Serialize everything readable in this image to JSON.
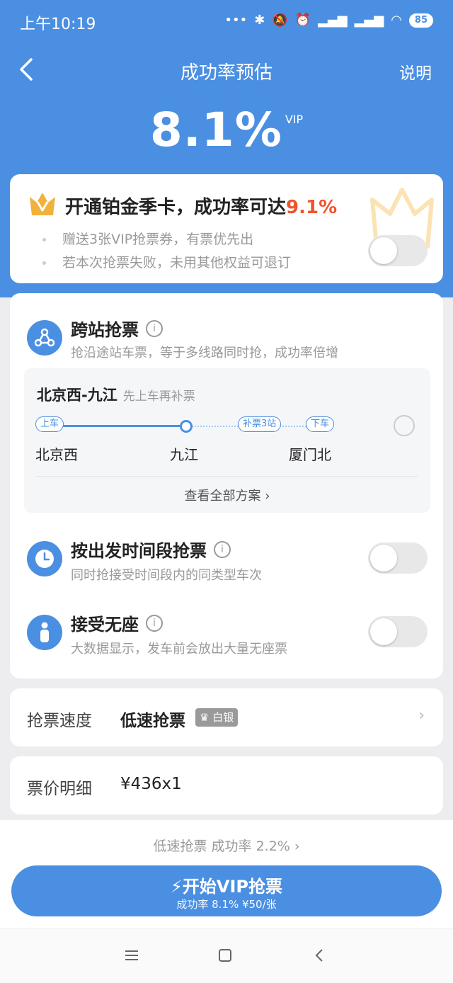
{
  "status_bar": {
    "time": "上午10:19",
    "battery": "85"
  },
  "header": {
    "title": "成功率预估",
    "help": "说明"
  },
  "rate": {
    "value": "8.1%",
    "vip_tag": "VIP"
  },
  "promo": {
    "headline": "开通铂金季卡，成功率可达",
    "headline_rate": "9.1%",
    "benefits": [
      "赠送3张VIP抢票券，有票优先出",
      "若本次抢票失败，未用其他权益可退订"
    ],
    "toggle_on": false
  },
  "cross_station": {
    "title": "跨站抢票",
    "desc": "抢沿途站车票，等于多线路同时抢，成功率倍增",
    "route_title": "北京西-九江",
    "route_note": "先上车再补票",
    "tag_board": "上车",
    "tag_supplement": "补票3站",
    "tag_alight": "下车",
    "stations": [
      "北京西",
      "九江",
      "厦门北"
    ],
    "view_all": "查看全部方案"
  },
  "time_slot": {
    "title": "按出发时间段抢票",
    "desc": "同时抢接受时间段内的同类型车次",
    "toggle_on": false
  },
  "no_seat": {
    "title": "接受无座",
    "desc": "大数据显示，发车前会放出大量无座票",
    "toggle_on": false
  },
  "speed": {
    "label": "抢票速度",
    "value": "低速抢票",
    "badge": "白银"
  },
  "price": {
    "label": "票价明细",
    "value": "¥436x1"
  },
  "footer": {
    "low_link": "低速抢票 成功率 2.2%",
    "cta_main": "开始VIP抢票",
    "cta_sub": "成功率 8.1% ¥50/张"
  },
  "colors": {
    "primary": "#4a8fe2",
    "highlight": "#f2532b",
    "gold": "#f0b23c"
  }
}
